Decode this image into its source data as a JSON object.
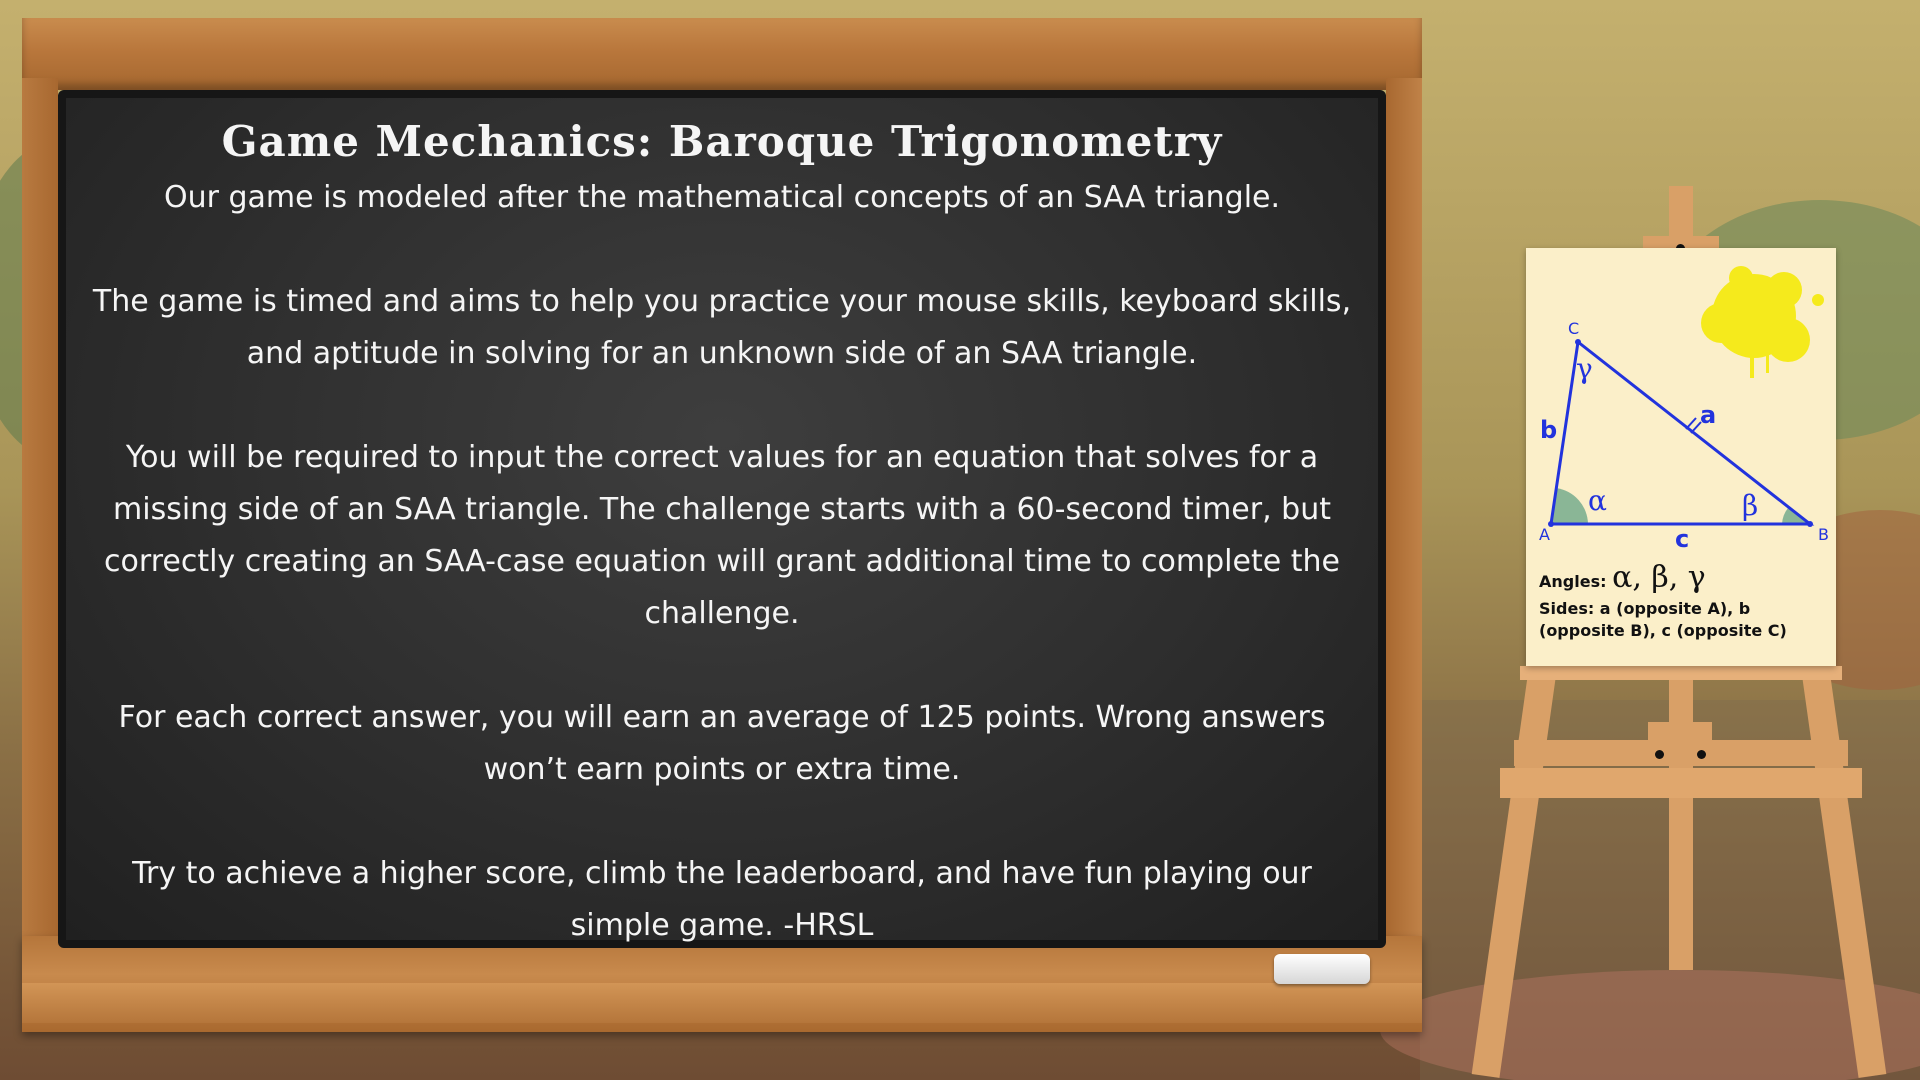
{
  "board": {
    "title": "Game Mechanics: Baroque Trigonometry",
    "intro": "Our game is modeled after the mathematical concepts of an SAA triangle.",
    "paragraphs": [
      "The game is timed and aims to help you practice your mouse skills, keyboard skills, and aptitude in solving for an unknown side of an SAA triangle.",
      "You will be required to input the correct values for an equation that solves for a missing side of an SAA triangle. The challenge starts with a 60-second timer, but correctly creating an SAA-case equation will grant additional time to complete the challenge.",
      "For each correct answer, you will earn an average of 125 points. Wrong answers won’t earn points or extra time.",
      "Try to achieve a higher score, climb the leaderboard, and have fun playing our simple game. -HRSL"
    ]
  },
  "diagram": {
    "vertex_a": "A",
    "vertex_b": "B",
    "vertex_c": "C",
    "side_a": "a",
    "side_b": "b",
    "side_c": "c",
    "angle_alpha": "α",
    "angle_beta": "β",
    "angle_gamma": "γ",
    "angles_label": "Angles:",
    "angles_symbols": "α, β, γ",
    "sides_text": "Sides: a (opposite A), b (opposite B), c (opposite C)",
    "colors": {
      "triangle": "#2233dd",
      "angle_fill": "#6ea88a",
      "sun": "#f5ea1c"
    }
  }
}
